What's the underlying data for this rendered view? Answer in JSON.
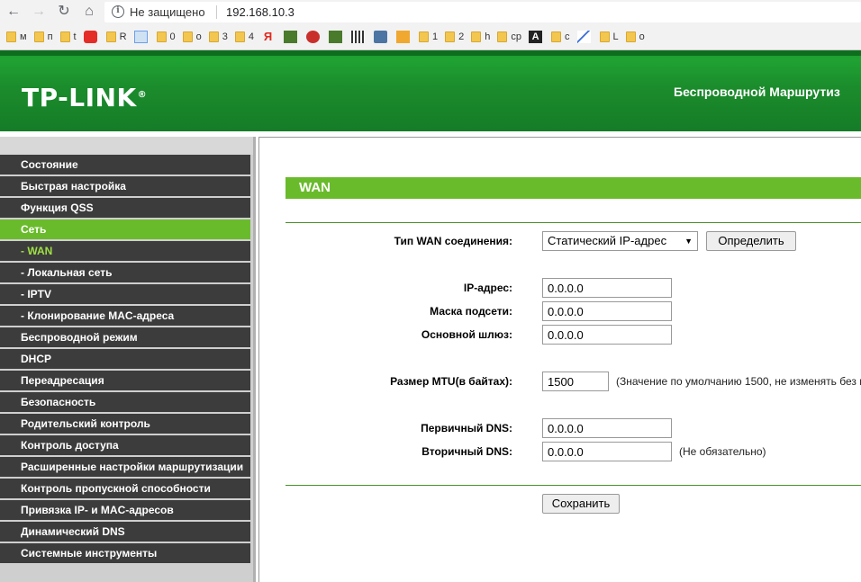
{
  "browser": {
    "security_label": "Не защищено",
    "url": "192.168.10.3",
    "bookmarks": [
      {
        "label": "м",
        "icon": "folder-icon"
      },
      {
        "label": "п",
        "icon": "folder-icon"
      },
      {
        "label": "t",
        "icon": "folder-icon"
      },
      {
        "label": "",
        "icon": "youtube-icon"
      },
      {
        "label": "R",
        "icon": "folder-icon"
      },
      {
        "label": "",
        "icon": "notepad-icon"
      },
      {
        "label": "0",
        "icon": "folder-icon"
      },
      {
        "label": "о",
        "icon": "folder-icon"
      },
      {
        "label": "3",
        "icon": "folder-icon"
      },
      {
        "label": "4",
        "icon": "folder-icon"
      },
      {
        "label": "",
        "icon": "yandex-icon"
      },
      {
        "label": "",
        "icon": "site-icon"
      },
      {
        "label": "",
        "icon": "star-icon"
      },
      {
        "label": "",
        "icon": "site-icon"
      },
      {
        "label": "",
        "icon": "film-icon"
      },
      {
        "label": "",
        "icon": "vk-icon"
      },
      {
        "label": "",
        "icon": "pma-icon"
      },
      {
        "label": "1",
        "icon": "folder-icon"
      },
      {
        "label": "2",
        "icon": "folder-icon"
      },
      {
        "label": "h",
        "icon": "folder-icon"
      },
      {
        "label": "cp",
        "icon": "folder-icon"
      },
      {
        "label": "",
        "icon": "a-icon"
      },
      {
        "label": "c",
        "icon": "folder-icon"
      },
      {
        "label": "",
        "icon": "chart-icon"
      },
      {
        "label": "L",
        "icon": "folder-icon"
      },
      {
        "label": "o",
        "icon": "folder-icon"
      }
    ]
  },
  "header": {
    "logo": "TP-LINK",
    "logo_mark": "®",
    "title": "Беспроводной Маршрутиз"
  },
  "sidebar": {
    "items": [
      {
        "label": "Состояние"
      },
      {
        "label": "Быстрая настройка"
      },
      {
        "label": "Функция QSS"
      },
      {
        "label": "Сеть"
      },
      {
        "label": "- WAN"
      },
      {
        "label": "- Локальная сеть"
      },
      {
        "label": "- IPTV"
      },
      {
        "label": "- Клонирование MAC-адреса"
      },
      {
        "label": "Беспроводной режим"
      },
      {
        "label": "DHCP"
      },
      {
        "label": "Переадресация"
      },
      {
        "label": "Безопасность"
      },
      {
        "label": "Родительский контроль"
      },
      {
        "label": "Контроль доступа"
      },
      {
        "label": "Расширенные настройки маршрутизации"
      },
      {
        "label": "Контроль пропускной способности"
      },
      {
        "label": "Привязка IP- и MAC-адресов"
      },
      {
        "label": "Динамический DNS"
      },
      {
        "label": "Системные инструменты"
      }
    ]
  },
  "wan": {
    "section_title": "WAN",
    "conn_type_label": "Тип WAN соединения:",
    "conn_type_value": "Статический IP-адрес",
    "detect_button": "Определить",
    "ip_label": "IP-адрес:",
    "ip_value": "0.0.0.0",
    "mask_label": "Маска подсети:",
    "mask_value": "0.0.0.0",
    "gateway_label": "Основной шлюз:",
    "gateway_value": "0.0.0.0",
    "mtu_label": "Размер MTU(в байтах):",
    "mtu_value": "1500",
    "mtu_note": "(Значение по умолчанию 1500, не изменять без н",
    "dns1_label": "Первичный DNS:",
    "dns1_value": "0.0.0.0",
    "dns2_label": "Вторичный DNS:",
    "dns2_value": "0.0.0.0",
    "dns2_note": "(Не обязательно)",
    "save_button": "Сохранить"
  },
  "colors": {
    "brand_green": "#1b8c2c",
    "accent_green": "#6abb2c",
    "sidebar_dark": "#3c3c3c"
  }
}
